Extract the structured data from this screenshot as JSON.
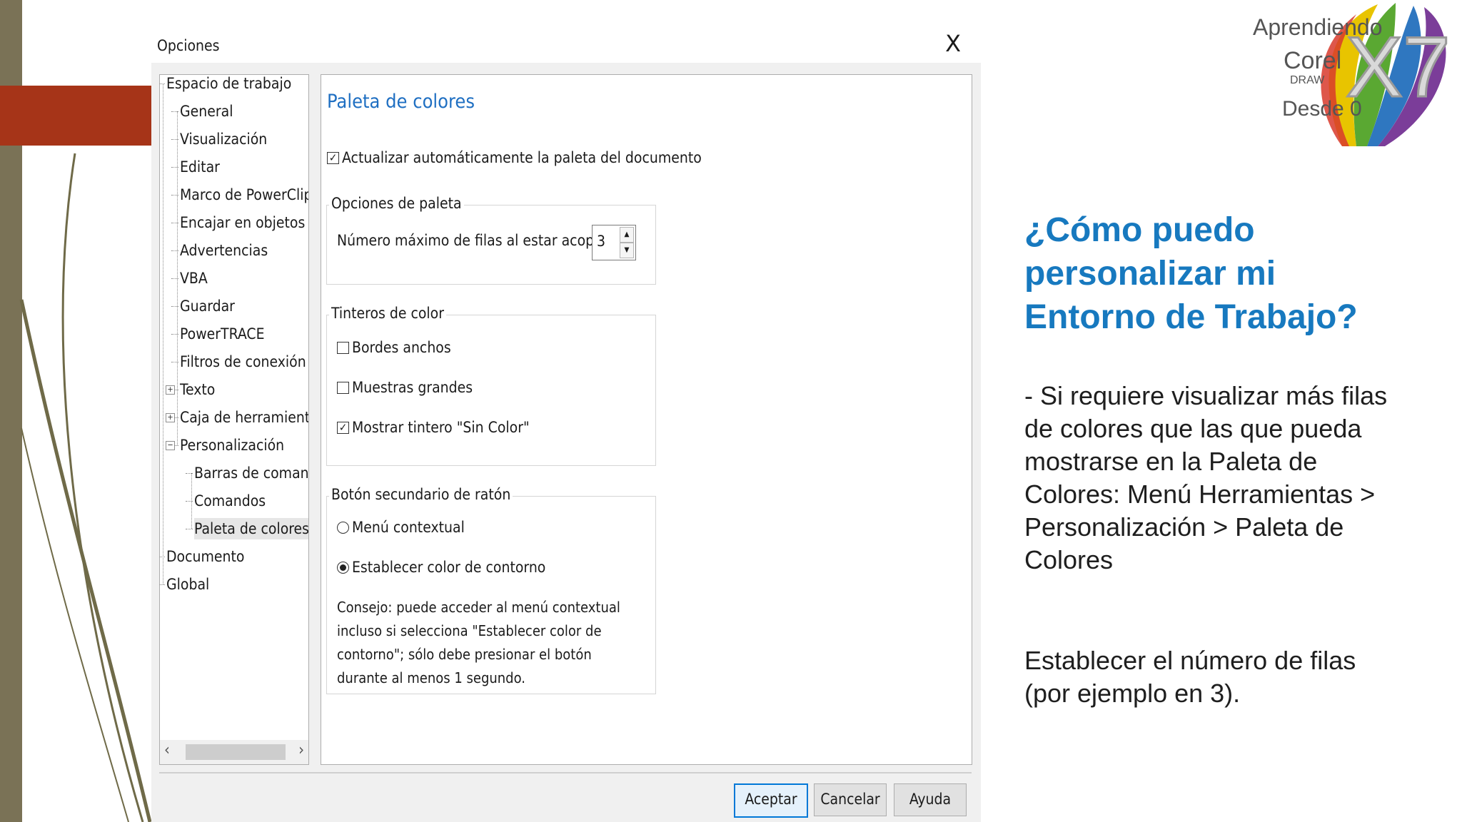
{
  "dialog": {
    "title": "Opciones",
    "close_label": "X",
    "tree": [
      {
        "label": "Espacio de trabajo",
        "level": 0
      },
      {
        "label": "General",
        "level": 1
      },
      {
        "label": "Visualización",
        "level": 1
      },
      {
        "label": "Editar",
        "level": 1
      },
      {
        "label": "Marco de PowerClip",
        "level": 1
      },
      {
        "label": "Encajar en objetos",
        "level": 1
      },
      {
        "label": "Advertencias",
        "level": 1
      },
      {
        "label": "VBA",
        "level": 1
      },
      {
        "label": "Guardar",
        "level": 1
      },
      {
        "label": "PowerTRACE",
        "level": 1
      },
      {
        "label": "Filtros de conexión",
        "level": 1
      },
      {
        "label": "Texto",
        "level": 1,
        "expander": "+"
      },
      {
        "label": "Caja de herramientas",
        "level": 1,
        "expander": "+"
      },
      {
        "label": "Personalización",
        "level": 1,
        "expander": "−"
      },
      {
        "label": "Barras de comando",
        "level": 2
      },
      {
        "label": "Comandos",
        "level": 2
      },
      {
        "label": "Paleta de colores",
        "level": 2,
        "selected": true
      },
      {
        "label": "Documento",
        "level": 0
      },
      {
        "label": "Global",
        "level": 0
      }
    ],
    "scroll_left": "‹",
    "scroll_right": "›",
    "content": {
      "heading": "Paleta de colores",
      "auto_update_label": "Actualizar automáticamente la paleta del documento",
      "auto_update_checked": true,
      "group_palette_title": "Opciones de paleta",
      "max_rows_label": "Número máximo de filas al estar acoplada:",
      "max_rows_value": "3",
      "group_swatches_title": "Tinteros de color",
      "wide_borders_label": "Bordes anchos",
      "wide_borders_checked": false,
      "large_swatches_label": "Muestras grandes",
      "large_swatches_checked": false,
      "no_color_label": "Mostrar tintero \"Sin Color\"",
      "no_color_checked": true,
      "group_right_click_title": "Botón secundario de ratón",
      "context_menu_label": "Menú contextual",
      "set_outline_label": "Establecer color de contorno",
      "selected_option": "set_outline",
      "tip": "Consejo: puede acceder al menú contextual incluso si selecciona \"Establecer color de contorno\"; sólo debe presionar el botón durante al menos 1 segundo."
    },
    "buttons": {
      "ok": "Aceptar",
      "cancel": "Cancelar",
      "help": "Ayuda"
    }
  },
  "logo": {
    "line1": "Aprendiendo",
    "line2": "Corel",
    "line3": "DRAW",
    "line4": "Desde 0",
    "mark": "X7"
  },
  "slide": {
    "question": "¿Cómo puedo personalizar mi Entorno de Trabajo?",
    "body": "- Si requiere visualizar más filas de colores que las que pueda mostrarse en la Paleta de Colores: Menú Herramientas > Personalización > Paleta de Colores",
    "body2": "Establecer el número de filas (por ejemplo en 3)."
  },
  "colors": {
    "accent_blue": "#1779bf",
    "red_block": "#a63418",
    "left_bar": "#7a7256"
  }
}
